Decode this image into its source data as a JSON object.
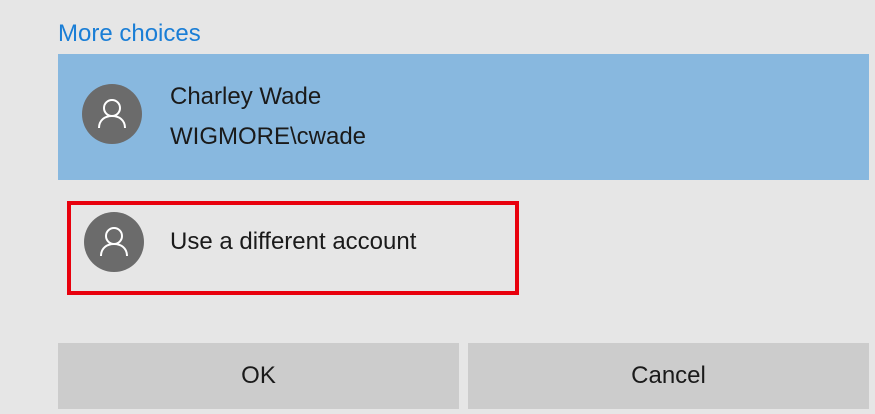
{
  "more_choices": {
    "label": "More choices"
  },
  "accounts": [
    {
      "name": "Charley Wade",
      "username": "WIGMORE\\cwade",
      "icon": "user-avatar-icon",
      "selected": true
    }
  ],
  "other_account": {
    "label": "Use a different account",
    "icon": "user-avatar-icon"
  },
  "buttons": {
    "ok_label": "OK",
    "cancel_label": "Cancel"
  },
  "colors": {
    "dialog_bg": "#e6e6e6",
    "link": "#1a7ed6",
    "selected_bg": "#88b8df",
    "avatar_bg": "#6b6b6b",
    "button_bg": "#cccccc",
    "highlight_border": "#e8000d"
  }
}
